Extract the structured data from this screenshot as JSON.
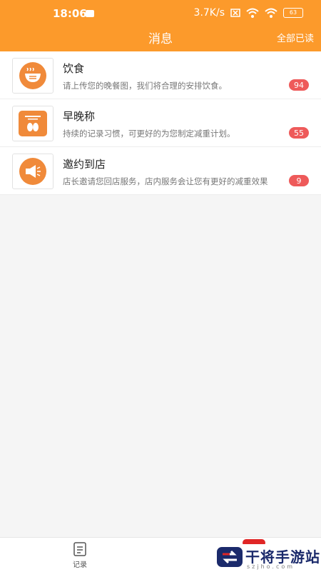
{
  "status_bar": {
    "time": "18:06",
    "network": "3.7K/s",
    "battery": "63"
  },
  "header": {
    "title": "消息",
    "read_all": "全部已读"
  },
  "messages": [
    {
      "title": "饮食",
      "preview": "请上传您的晚餐图，我们将合理的安排饮食。",
      "count": "94",
      "icon": "diet-bowl-icon"
    },
    {
      "title": "早晚称",
      "preview": "持续的记录习惯，可更好的为您制定减重计划。",
      "count": "55",
      "icon": "scale-feet-icon"
    },
    {
      "title": "邀约到店",
      "preview": "店长邀请您回店服务，店内服务会让您有更好的减重效果",
      "count": "9",
      "icon": "megaphone-icon"
    }
  ],
  "tabbar": {
    "record_label": "记录"
  },
  "watermark": {
    "brand": "干将手游站",
    "url": "szjho.com"
  },
  "colors": {
    "accent": "#fc9a2b",
    "badge": "#ee5a5a",
    "icon": "#f08a3a"
  }
}
